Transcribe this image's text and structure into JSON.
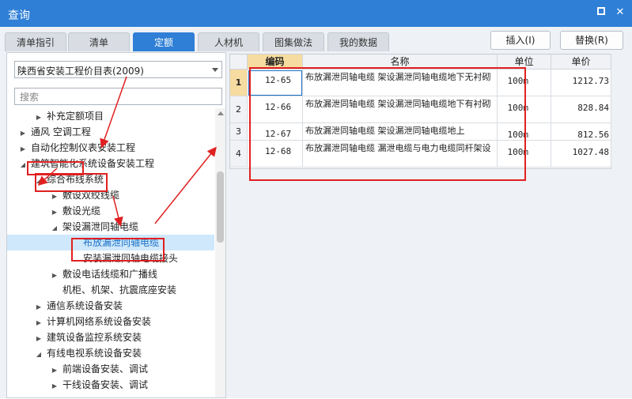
{
  "window": {
    "title": "查询",
    "minimize_icon": "minimize-icon",
    "close_icon": "close-icon"
  },
  "tabs": [
    {
      "label": "清单指引",
      "active": false
    },
    {
      "label": "清单",
      "active": false
    },
    {
      "label": "定额",
      "active": true
    },
    {
      "label": "人材机",
      "active": false
    },
    {
      "label": "图集做法",
      "active": false
    },
    {
      "label": "我的数据",
      "active": false
    }
  ],
  "buttons": {
    "insert": "插入(I)",
    "replace": "替换(R)"
  },
  "left": {
    "library_select": "陕西省安装工程价目表(2009)",
    "search_placeholder": "搜索",
    "tree": [
      {
        "label": "补充定额项目",
        "expander": "collapsed",
        "level": 2
      },
      {
        "label": "通风 空调工程",
        "expander": "collapsed",
        "level": 1
      },
      {
        "label": "自动化控制仪表安装工程",
        "expander": "collapsed",
        "level": 1
      },
      {
        "label": "建筑智能化系统设备安装工程",
        "expander": "expanded",
        "level": 1
      },
      {
        "label": "综合布线系统",
        "expander": "expanded",
        "level": 2
      },
      {
        "label": "敷设双绞线缆",
        "expander": "collapsed",
        "level": 3
      },
      {
        "label": "敷设光缆",
        "expander": "collapsed",
        "level": 3
      },
      {
        "label": "架设漏泄同轴电缆",
        "expander": "expanded",
        "level": 3
      },
      {
        "label": "布放漏泄同轴电缆",
        "expander": "none",
        "level": 4,
        "selected": true
      },
      {
        "label": "安装漏泄同轴电缆接头",
        "expander": "none",
        "level": 4
      },
      {
        "label": "敷设电话线缆和广播线",
        "expander": "collapsed",
        "level": 3
      },
      {
        "label": "机柜、机架、抗震底座安装",
        "expander": "none",
        "level": 3
      },
      {
        "label": "通信系统设备安装",
        "expander": "collapsed",
        "level": 2
      },
      {
        "label": "计算机网络系统设备安装",
        "expander": "collapsed",
        "level": 2
      },
      {
        "label": "建筑设备监控系统安装",
        "expander": "collapsed",
        "level": 2
      },
      {
        "label": "有线电视系统设备安装",
        "expander": "expanded",
        "level": 2
      },
      {
        "label": "前端设备安装、调试",
        "expander": "collapsed",
        "level": 3
      },
      {
        "label": "干线设备安装、调试",
        "expander": "collapsed",
        "level": 3
      }
    ]
  },
  "grid": {
    "headers": {
      "code": "编码",
      "name": "名称",
      "unit": "单位",
      "price": "单价"
    },
    "rows": [
      {
        "no": "1",
        "code": "12-65",
        "name": "布放漏泄同轴电缆 架设漏泄同轴电缆地下无衬砌",
        "unit": "100m",
        "price": "1212.73"
      },
      {
        "no": "2",
        "code": "12-66",
        "name": "布放漏泄同轴电缆 架设漏泄同轴电缆地下有衬砌",
        "unit": "100m",
        "price": "828.84"
      },
      {
        "no": "3",
        "code": "12-67",
        "name": "布放漏泄同轴电缆 架设漏泄同轴电缆地上",
        "unit": "100m",
        "price": "812.56"
      },
      {
        "no": "4",
        "code": "12-68",
        "name": "布放漏泄同轴电缆 漏泄电缆与电力电缆同杆架设",
        "unit": "100m",
        "price": "1027.48"
      }
    ]
  },
  "colors": {
    "titlebar": "#2f7fd6",
    "annotation": "#e02020",
    "selected_row": "#cfe8fb"
  }
}
